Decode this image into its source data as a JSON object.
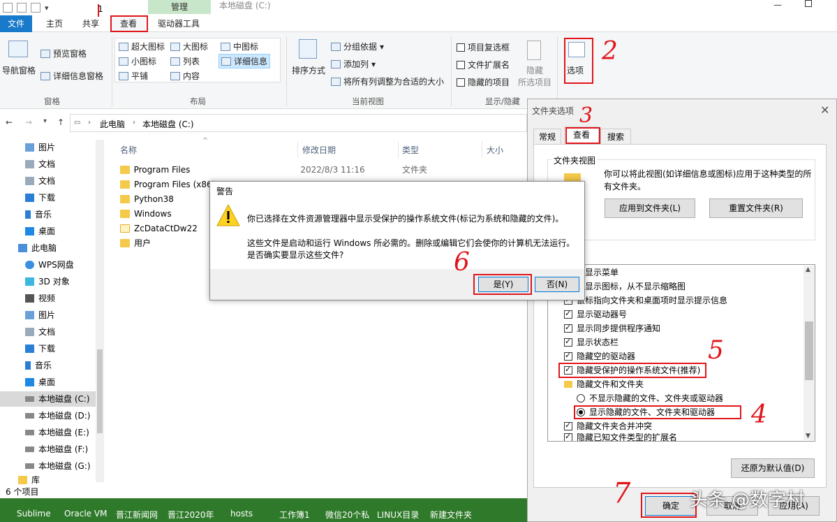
{
  "window": {
    "title": "本地磁盘 (C:)",
    "context_tab_group": "管理",
    "tabs": [
      "文件",
      "主页",
      "共享",
      "查看",
      "驱动器工具"
    ]
  },
  "ribbon": {
    "pane": {
      "nav_pane": "导航窗格",
      "preview_pane": "预览窗格",
      "details_pane": "详细信息窗格",
      "group": "窗格"
    },
    "layout": {
      "items": [
        "超大图标",
        "大图标",
        "中图标",
        "小图标",
        "列表",
        "详细信息",
        "平铺",
        "内容"
      ],
      "group": "布局"
    },
    "current_view": {
      "sort": "排序方式",
      "group_by": "分组依据",
      "add_columns": "添加列",
      "fit_columns": "将所有列调整为合适的大小",
      "group": "当前视图"
    },
    "show_hide": {
      "item_checkboxes": "项目复选框",
      "file_extensions": "文件扩展名",
      "hidden_items": "隐藏的项目",
      "hide_selected_1": "隐藏",
      "hide_selected_2": "所选项目",
      "group": "显示/隐藏"
    },
    "options": "选项"
  },
  "address": {
    "crumbs": [
      "此电脑",
      "本地磁盘 (C:)"
    ]
  },
  "nav_pane": {
    "items": [
      "图片",
      "文档",
      "文档",
      "下载",
      "音乐",
      "桌面",
      "此电脑",
      "WPS网盘",
      "3D 对象",
      "视频",
      "图片",
      "文档",
      "下载",
      "音乐",
      "桌面",
      "本地磁盘 (C:)",
      "本地磁盘 (D:)",
      "本地磁盘 (E:)",
      "本地磁盘 (F:)",
      "本地磁盘 (G:)",
      "库"
    ]
  },
  "file_list": {
    "columns": [
      "名称",
      "修改日期",
      "类型",
      "大小"
    ],
    "rows": [
      {
        "name": "Program Files",
        "date": "2022/8/3 11:16",
        "type": "文件夹"
      },
      {
        "name": "Program Files (x86)",
        "date": "",
        "type": ""
      },
      {
        "name": "Python38",
        "date": "",
        "type": ""
      },
      {
        "name": "Windows",
        "date": "",
        "type": ""
      },
      {
        "name": "ZcDataCtDw22",
        "date": "",
        "type": ""
      },
      {
        "name": "用户",
        "date": "",
        "type": ""
      }
    ]
  },
  "status_bar": "6 个项目",
  "folder_options": {
    "title": "文件夹选项",
    "tabs": [
      "常规",
      "查看",
      "搜索"
    ],
    "folder_views_label": "文件夹视图",
    "folder_views_text_1": "你可以将此视图(如详细信息或图标)应用于这种类型的所",
    "folder_views_text_2": "有文件夹。",
    "apply_button": "应用到文件夹(L)",
    "reset_button": "重置文件夹(R)",
    "advanced_items": [
      {
        "label": "终显示菜单",
        "kind": "check",
        "checked": false
      },
      {
        "label": "终显示图标，从不显示缩略图",
        "kind": "check",
        "checked": false
      },
      {
        "label": "鼠标指向文件夹和桌面项时显示提示信息",
        "kind": "check",
        "checked": true
      },
      {
        "label": "显示驱动器号",
        "kind": "check",
        "checked": true
      },
      {
        "label": "显示同步提供程序通知",
        "kind": "check",
        "checked": true
      },
      {
        "label": "显示状态栏",
        "kind": "check",
        "checked": true
      },
      {
        "label": "隐藏空的驱动器",
        "kind": "check",
        "checked": true
      },
      {
        "label": "隐藏受保护的操作系统文件(推荐)",
        "kind": "check",
        "checked": true
      },
      {
        "label": "隐藏文件和文件夹",
        "kind": "folder",
        "checked": false
      },
      {
        "label": "不显示隐藏的文件、文件夹或驱动器",
        "kind": "radio",
        "checked": false
      },
      {
        "label": "显示隐藏的文件、文件夹和驱动器",
        "kind": "radio",
        "checked": true
      },
      {
        "label": "隐藏文件夹合并冲突",
        "kind": "check",
        "checked": true
      },
      {
        "label": "隐藏已知文件类型的扩展名",
        "kind": "check",
        "checked": true
      }
    ],
    "restore_defaults": "还原为默认值(D)",
    "ok": "确定",
    "cancel": "取消",
    "apply": "应用(A)"
  },
  "warning": {
    "title": "警告",
    "line1": "你已选择在文件资源管理器中显示受保护的操作系统文件(标记为系统和隐藏的文件)。",
    "line2": "这些文件是启动和运行 Windows 所必需的。删除或编辑它们会使你的计算机无法运行。",
    "line3": "是否确实要显示这些文件?",
    "yes": "是(Y)",
    "no": "否(N)"
  },
  "annotations": [
    "1",
    "2",
    "3",
    "4",
    "5",
    "6",
    "7"
  ],
  "taskbar": [
    "Sublime",
    "Oracle VM",
    "晋江新闻网",
    "晋江2020年",
    "hosts",
    "工作簿1",
    "微信20个私",
    "LINUX目录",
    "新建文件夹"
  ],
  "watermark": "头条 @数字村",
  "colors": {
    "accent": "#1979ca",
    "annotation": "#e0151a",
    "taskbar": "#2f7a2a",
    "folder": "#f5c94a"
  }
}
